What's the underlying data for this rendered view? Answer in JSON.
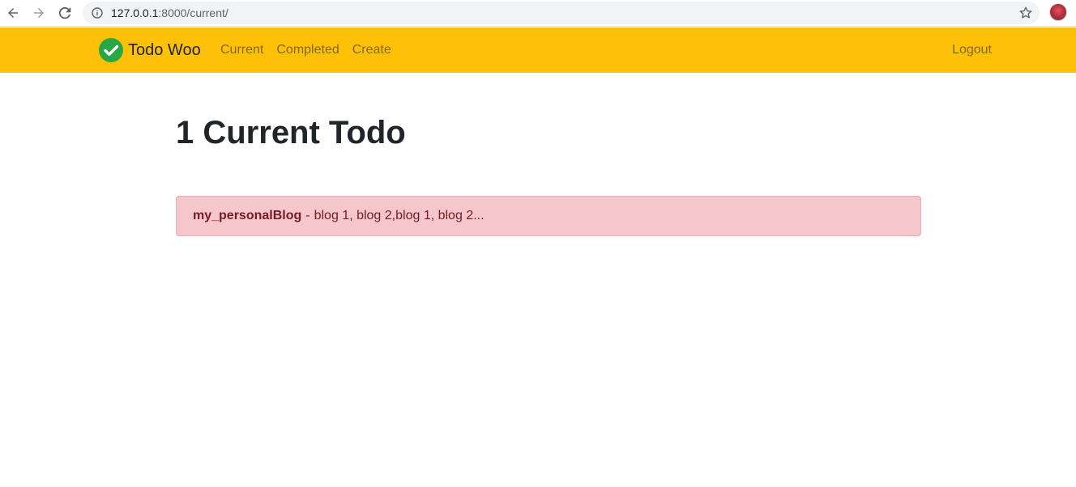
{
  "browser": {
    "url_host": "127.0.0.1",
    "url_path": ":8000/current/"
  },
  "navbar": {
    "brand": "Todo Woo",
    "links": [
      "Current",
      "Completed",
      "Create"
    ],
    "logout": "Logout",
    "bg_color": "#ffc107"
  },
  "main": {
    "title": "1 Current Todo",
    "todos": [
      {
        "title": "my_personalBlog",
        "separator": "-",
        "memo": "blog 1, blog 2,blog 1, blog 2..."
      }
    ]
  },
  "icons": {
    "back": "arrow-left-icon",
    "forward": "arrow-right-icon",
    "reload": "reload-icon",
    "info": "info-icon",
    "star": "star-icon",
    "brand": "check-circle-icon"
  },
  "colors": {
    "todo_bg": "#f5c6cb",
    "todo_text": "#721c24",
    "brand_check": "#28a745"
  }
}
